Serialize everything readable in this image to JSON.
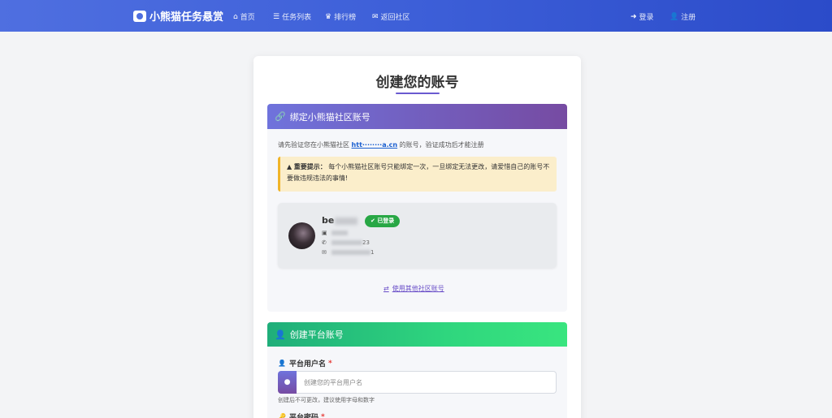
{
  "navbar": {
    "brand": "小熊猫任务悬赏",
    "items": [
      {
        "icon": "home-icon",
        "glyph": "⌂",
        "label": "首页"
      },
      {
        "icon": "list-icon",
        "glyph": "☰",
        "label": "任务列表"
      },
      {
        "icon": "trophy-icon",
        "glyph": "♛",
        "label": "排行榜"
      },
      {
        "icon": "comments-icon",
        "glyph": "✉",
        "label": "返回社区"
      }
    ],
    "login": "登录",
    "register": "注册"
  },
  "page": {
    "title": "创建您的账号"
  },
  "bind_section": {
    "header": "绑定小熊猫社区账号",
    "verify_prefix": "请先验证您在小熊猫社区",
    "verify_link": "htt········a.cn",
    "verify_suffix": "的账号，验证成功后才能注册",
    "warning_title": "重要提示：",
    "warning_text": "每个小熊猫社区账号只能绑定一次，一旦绑定无法更改，请爱惜自己的账号不要做违规违法的事情!",
    "user": {
      "name_prefix": "be",
      "badge": "已登录",
      "phone_suffix": "23",
      "email_suffix": "1"
    },
    "switch_link": "使用其他社区账号"
  },
  "create_section": {
    "header": "创建平台账号",
    "username_label": "平台用户名",
    "username_placeholder": "创建您的平台用户名",
    "username_help": "创建后不可更改，建议使用字母和数字",
    "password_label": "平台密码"
  },
  "colors": {
    "nav_start": "#4f6fe0",
    "nav_end": "#2b4bc9",
    "purple_accent": "#764ba2",
    "green_accent": "#2fd67e",
    "badge_green": "#28a745",
    "warning_bg": "#fbeecb"
  }
}
